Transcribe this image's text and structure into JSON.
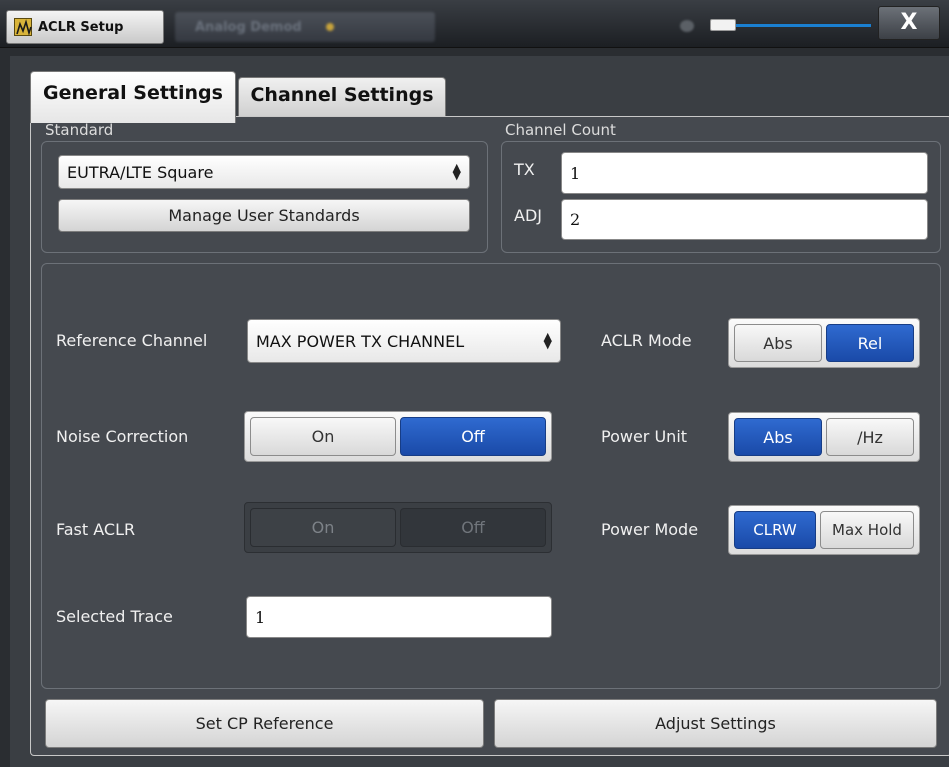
{
  "window": {
    "title": "ACLR Setup",
    "background_tab": "Analog Demod",
    "close_label": "X"
  },
  "tabs": [
    {
      "label": "General Settings",
      "active": true
    },
    {
      "label": "Channel Settings",
      "active": false
    }
  ],
  "standard": {
    "group_label": "Standard",
    "selected": "EUTRA/LTE Square",
    "manage_label": "Manage User Standards"
  },
  "channel_count": {
    "group_label": "Channel Count",
    "tx_label": "TX",
    "tx_value": "1",
    "adj_label": "ADJ",
    "adj_value": "2"
  },
  "settings": {
    "reference_channel": {
      "label": "Reference Channel",
      "value": "MAX POWER TX CHANNEL"
    },
    "noise_correction": {
      "label": "Noise Correction",
      "options": [
        "On",
        "Off"
      ],
      "selected": "Off"
    },
    "fast_aclr": {
      "label": "Fast ACLR",
      "options": [
        "On",
        "Off"
      ],
      "selected": "Off",
      "enabled": false
    },
    "selected_trace": {
      "label": "Selected Trace",
      "value": "1"
    },
    "aclr_mode": {
      "label": "ACLR Mode",
      "options": [
        "Abs",
        "Rel"
      ],
      "selected": "Rel"
    },
    "power_unit": {
      "label": "Power Unit",
      "options": [
        "Abs",
        "/Hz"
      ],
      "selected": "Abs"
    },
    "power_mode": {
      "label": "Power Mode",
      "options": [
        "CLRW",
        "Max Hold"
      ],
      "selected": "CLRW"
    }
  },
  "buttons": {
    "set_cp_reference": "Set CP Reference",
    "adjust_settings": "Adjust Settings"
  },
  "colors": {
    "accent_blue": "#1f55b9",
    "panel_bg": "#45494f",
    "dialog_bg": "#3a3e43"
  }
}
